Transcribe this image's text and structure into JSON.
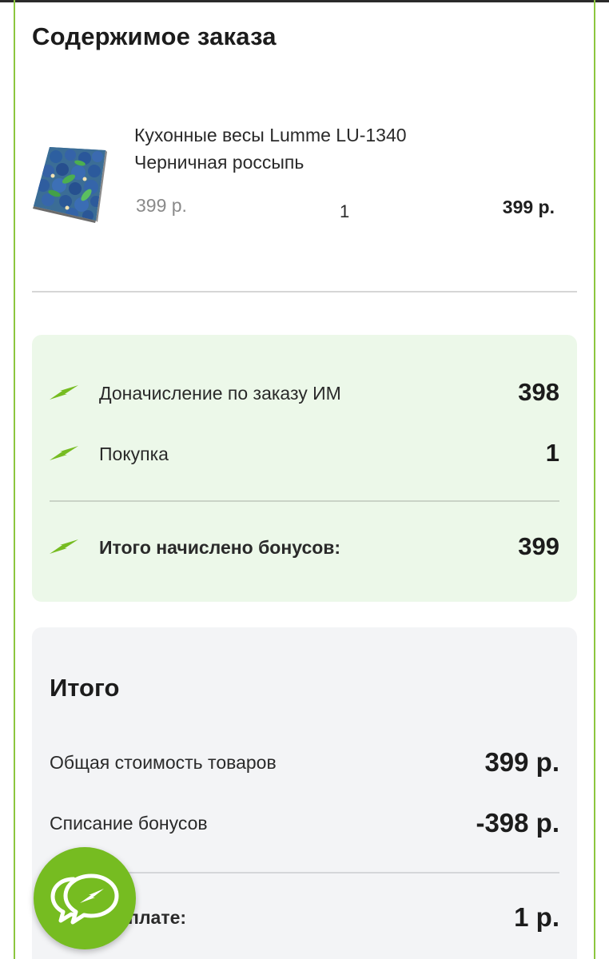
{
  "section_title": "Содержимое заказа",
  "order_item": {
    "name": "Кухонные весы Lumme LU-1340 Черничная россыпь",
    "unit_price": "399 р.",
    "quantity": "1",
    "line_total": "399 р.",
    "image_icon": "kitchen-scale-blueberry-image"
  },
  "bonuses": {
    "rows": [
      {
        "label": "Доначисление по заказу ИМ",
        "value": "398",
        "icon": "lightning-icon"
      },
      {
        "label": "Покупка",
        "value": "1",
        "icon": "lightning-icon"
      }
    ],
    "total_label": "Итого начислено бонусов:",
    "total_value": "399"
  },
  "summary": {
    "title": "Итого",
    "goods_total_label": "Общая стоимость товаров",
    "goods_total_value": "399 р.",
    "bonus_writeoff_label": "Списание бонусов",
    "bonus_writeoff_value": "-398 р.",
    "to_pay_label_visible": "оплате:",
    "to_pay_value": "1 р."
  },
  "chat_button": {
    "icon": "chat-bubbles-lightning-icon"
  },
  "colors": {
    "accent_green": "#76bc21",
    "frame_green": "#8cc63f",
    "bonus_card_bg": "#ecf8e9",
    "summary_card_bg": "#f3f4f6"
  }
}
